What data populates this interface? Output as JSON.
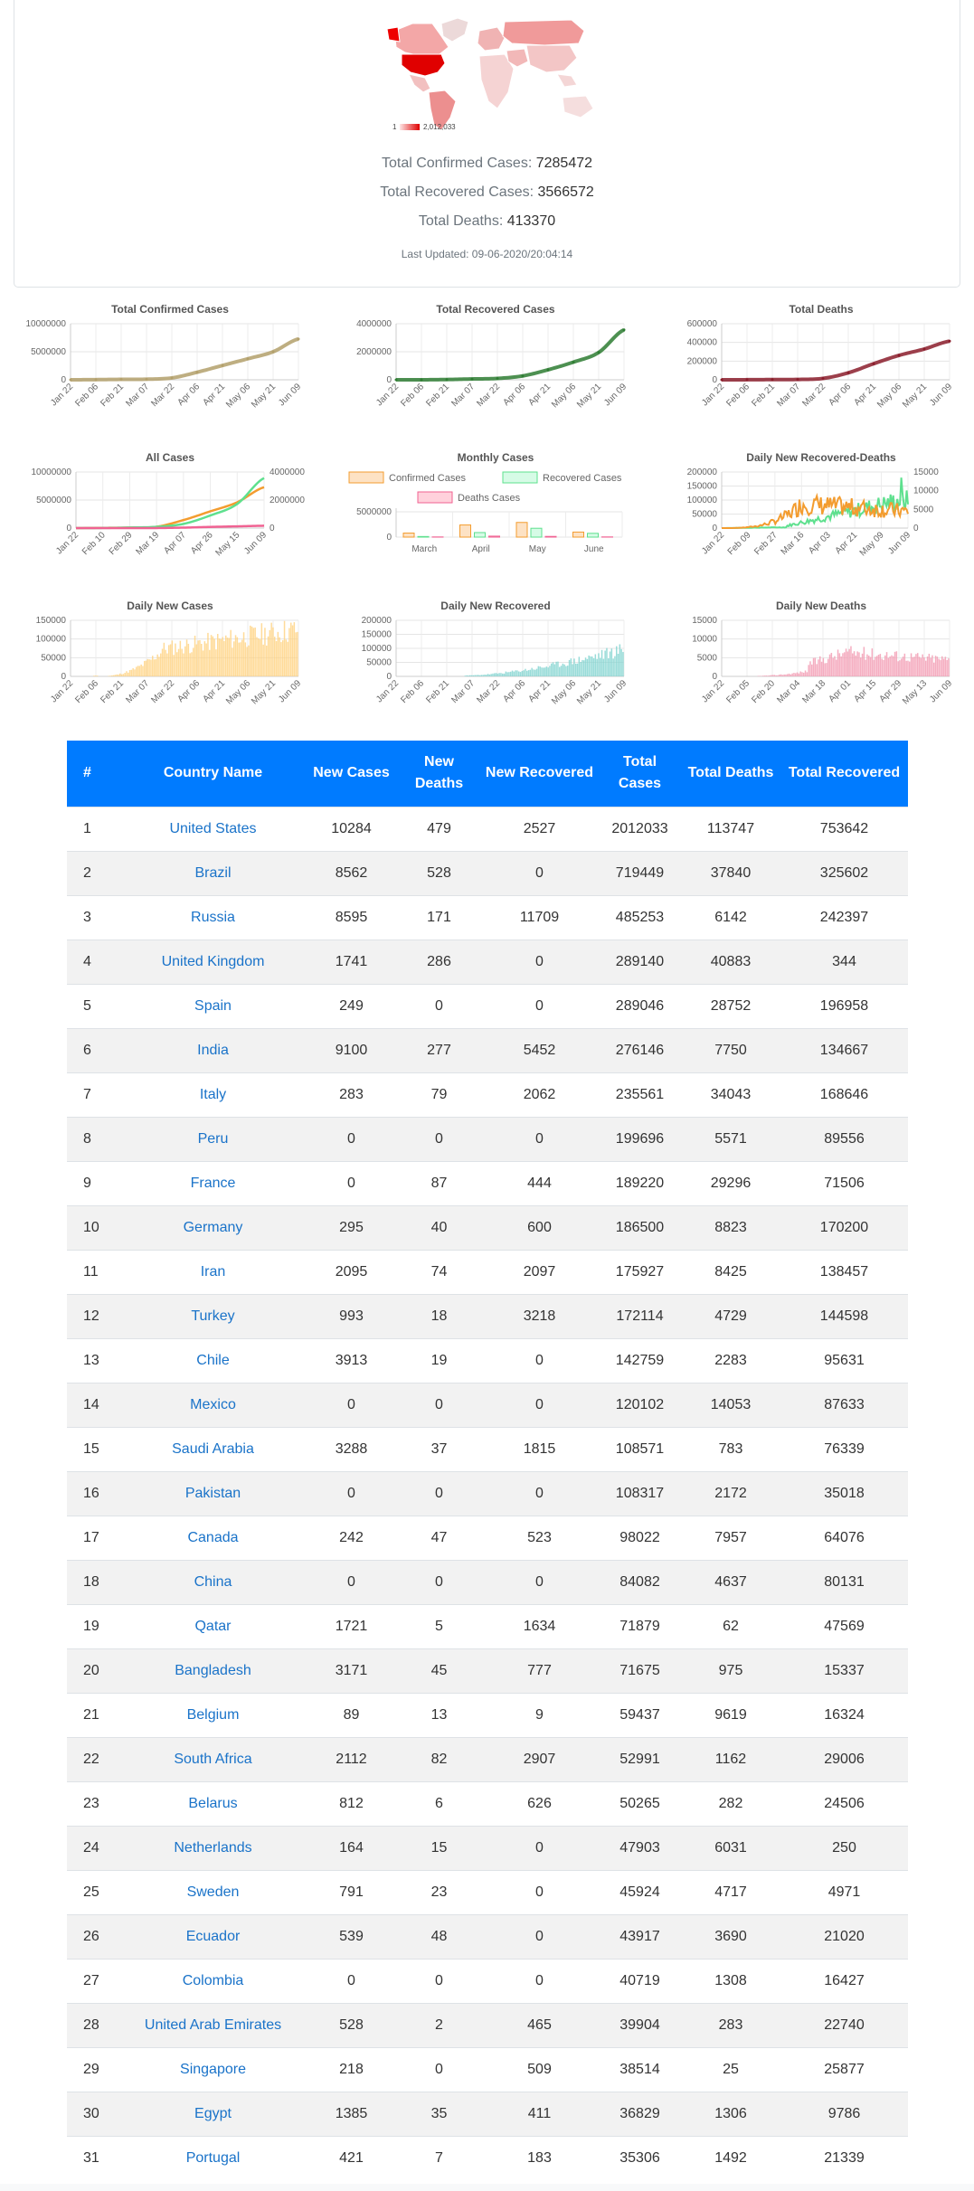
{
  "summary": {
    "map_legend_min": "1",
    "map_legend_max": "2,012,033",
    "confirmed_label": "Total Confirmed Cases:",
    "confirmed_value": "7285472",
    "recovered_label": "Total Recovered Cases:",
    "recovered_value": "3566572",
    "deaths_label": "Total Deaths:",
    "deaths_value": "413370",
    "last_updated": "Last Updated: 09-06-2020/20:04:14"
  },
  "colors": {
    "confirmed": "#b3a06b",
    "recovered": "#2e7d32",
    "deaths": "#8b1d2b",
    "confirmed_fill": "#fde2c4",
    "confirmed_line": "#f39c2f",
    "recovered_fill": "#d6fbe6",
    "recovered_line": "#5ee08e",
    "deaths_fill": "#ffd1dc",
    "deaths_line": "#f06292",
    "daily_cases_bar": "#ffd27f",
    "daily_recovered_bar": "#7fd3d0",
    "daily_deaths_bar": "#f29ab1",
    "table_header_bg": "#007bff",
    "link": "#1a73c9"
  },
  "chart_data": [
    {
      "id": "total_confirmed",
      "type": "line",
      "title": "Total Confirmed Cases",
      "x": [
        "Jan 22",
        "Feb 06",
        "Feb 21",
        "Mar 07",
        "Mar 22",
        "Apr 06",
        "Apr 21",
        "May 06",
        "May 21",
        "Jun 09"
      ],
      "ylim": [
        0,
        10000000
      ],
      "yticks": [
        "10000000",
        "5000000",
        "0"
      ],
      "series": [
        {
          "values": [
            555,
            28000,
            76000,
            106000,
            335000,
            1346000,
            2550000,
            3750000,
            5000000,
            7285472
          ]
        }
      ]
    },
    {
      "id": "total_recovered",
      "type": "line",
      "title": "Total Recovered Cases",
      "x": [
        "Jan 22",
        "Feb 06",
        "Feb 21",
        "Mar 07",
        "Mar 22",
        "Apr 06",
        "Apr 21",
        "May 06",
        "May 21",
        "Jun 09"
      ],
      "ylim": [
        0,
        4000000
      ],
      "yticks": [
        "4000000",
        "2000000",
        "0"
      ],
      "series": [
        {
          "values": [
            28,
            650,
            18900,
            59000,
            97000,
            276000,
            715000,
            1260000,
            1950000,
            3566572
          ]
        }
      ]
    },
    {
      "id": "total_deaths",
      "type": "line",
      "title": "Total Deaths",
      "x": [
        "Jan 22",
        "Feb 06",
        "Feb 21",
        "Mar 07",
        "Mar 22",
        "Apr 06",
        "Apr 21",
        "May 06",
        "May 21",
        "Jun 09"
      ],
      "ylim": [
        0,
        600000
      ],
      "yticks": [
        "600000",
        "400000",
        "200000",
        "0"
      ],
      "series": [
        {
          "values": [
            17,
            636,
            2250,
            3550,
            14800,
            74700,
            172000,
            261000,
            329000,
            413370
          ]
        }
      ]
    },
    {
      "id": "all_cases",
      "type": "line",
      "title": "All Cases",
      "x": [
        "Jan 22",
        "Feb 10",
        "Feb 29",
        "Mar 19",
        "Apr 07",
        "Apr 26",
        "May 15",
        "Jun 09"
      ],
      "ylim": [
        0,
        10000000
      ],
      "yticks": [
        "10000000",
        "5000000",
        "0"
      ],
      "y2ticks": [
        "4000000",
        "2000000",
        "0"
      ],
      "series": [
        {
          "values": [
            555,
            43000,
            86000,
            242000,
            1430000,
            2990000,
            4600000,
            7285472
          ]
        },
        {
          "values": [
            28,
            4700,
            40000,
            88000,
            300000,
            900000,
            1720000,
            3566572
          ]
        },
        {
          "values": [
            17,
            900,
            2900,
            9900,
            82000,
            206000,
            310000,
            413370
          ]
        }
      ]
    },
    {
      "id": "monthly_cases",
      "type": "bar",
      "title": "Monthly Cases",
      "categories": [
        "March",
        "April",
        "May",
        "June"
      ],
      "ylim": [
        0,
        8000000
      ],
      "yticks": [
        "5000000",
        "0"
      ],
      "series": [
        {
          "name": "Confirmed Cases",
          "values": [
            800000,
            2400000,
            2900000,
            1000000
          ]
        },
        {
          "name": "Recovered Cases",
          "values": [
            120000,
            900000,
            1750000,
            750000
          ]
        },
        {
          "name": "Deaths Cases",
          "values": [
            36000,
            195000,
            140000,
            40000
          ]
        }
      ]
    },
    {
      "id": "daily_recovered_deaths",
      "type": "line",
      "title": "Daily New Recovered-Deaths",
      "x": [
        "Jan 22",
        "Feb 09",
        "Feb 27",
        "Mar 16",
        "Apr 03",
        "Apr 21",
        "May 09",
        "Jun 09"
      ],
      "ylim": [
        0,
        200000
      ],
      "yticks": [
        "200000",
        "150000",
        "100000",
        "50000",
        "0"
      ],
      "y2ticks": [
        "15000",
        "10000",
        "5000",
        "0"
      ]
    },
    {
      "id": "daily_new_cases",
      "type": "bar",
      "title": "Daily New Cases",
      "x": [
        "Jan 22",
        "Feb 06",
        "Feb 21",
        "Mar 07",
        "Mar 22",
        "Apr 06",
        "Apr 21",
        "May 06",
        "May 21",
        "Jun 09"
      ],
      "ylim": [
        0,
        150000
      ],
      "yticks": [
        "150000",
        "100000",
        "50000",
        "0"
      ]
    },
    {
      "id": "daily_new_recovered",
      "type": "bar",
      "title": "Daily New Recovered",
      "x": [
        "Jan 22",
        "Feb 06",
        "Feb 21",
        "Mar 07",
        "Mar 22",
        "Apr 06",
        "Apr 21",
        "May 06",
        "May 21",
        "Jun 09"
      ],
      "ylim": [
        0,
        200000
      ],
      "yticks": [
        "200000",
        "150000",
        "100000",
        "50000",
        "0"
      ]
    },
    {
      "id": "daily_new_deaths",
      "type": "bar",
      "title": "Daily New Deaths",
      "x": [
        "Jan 22",
        "Feb 05",
        "Feb 20",
        "Mar 04",
        "Mar 18",
        "Apr 01",
        "Apr 15",
        "Apr 29",
        "May 13",
        "Jun 09"
      ],
      "ylim": [
        0,
        15000
      ],
      "yticks": [
        "15000",
        "10000",
        "5000",
        "0"
      ]
    }
  ],
  "table": {
    "headers": [
      "#",
      "Country Name",
      "New Cases",
      "New Deaths",
      "New Recovered",
      "Total Cases",
      "Total Deaths",
      "Total Recovered"
    ],
    "rows": [
      [
        "1",
        "United States",
        "10284",
        "479",
        "2527",
        "2012033",
        "113747",
        "753642"
      ],
      [
        "2",
        "Brazil",
        "8562",
        "528",
        "0",
        "719449",
        "37840",
        "325602"
      ],
      [
        "3",
        "Russia",
        "8595",
        "171",
        "11709",
        "485253",
        "6142",
        "242397"
      ],
      [
        "4",
        "United Kingdom",
        "1741",
        "286",
        "0",
        "289140",
        "40883",
        "344"
      ],
      [
        "5",
        "Spain",
        "249",
        "0",
        "0",
        "289046",
        "28752",
        "196958"
      ],
      [
        "6",
        "India",
        "9100",
        "277",
        "5452",
        "276146",
        "7750",
        "134667"
      ],
      [
        "7",
        "Italy",
        "283",
        "79",
        "2062",
        "235561",
        "34043",
        "168646"
      ],
      [
        "8",
        "Peru",
        "0",
        "0",
        "0",
        "199696",
        "5571",
        "89556"
      ],
      [
        "9",
        "France",
        "0",
        "87",
        "444",
        "189220",
        "29296",
        "71506"
      ],
      [
        "10",
        "Germany",
        "295",
        "40",
        "600",
        "186500",
        "8823",
        "170200"
      ],
      [
        "11",
        "Iran",
        "2095",
        "74",
        "2097",
        "175927",
        "8425",
        "138457"
      ],
      [
        "12",
        "Turkey",
        "993",
        "18",
        "3218",
        "172114",
        "4729",
        "144598"
      ],
      [
        "13",
        "Chile",
        "3913",
        "19",
        "0",
        "142759",
        "2283",
        "95631"
      ],
      [
        "14",
        "Mexico",
        "0",
        "0",
        "0",
        "120102",
        "14053",
        "87633"
      ],
      [
        "15",
        "Saudi Arabia",
        "3288",
        "37",
        "1815",
        "108571",
        "783",
        "76339"
      ],
      [
        "16",
        "Pakistan",
        "0",
        "0",
        "0",
        "108317",
        "2172",
        "35018"
      ],
      [
        "17",
        "Canada",
        "242",
        "47",
        "523",
        "98022",
        "7957",
        "64076"
      ],
      [
        "18",
        "China",
        "0",
        "0",
        "0",
        "84082",
        "4637",
        "80131"
      ],
      [
        "19",
        "Qatar",
        "1721",
        "5",
        "1634",
        "71879",
        "62",
        "47569"
      ],
      [
        "20",
        "Bangladesh",
        "3171",
        "45",
        "777",
        "71675",
        "975",
        "15337"
      ],
      [
        "21",
        "Belgium",
        "89",
        "13",
        "9",
        "59437",
        "9619",
        "16324"
      ],
      [
        "22",
        "South Africa",
        "2112",
        "82",
        "2907",
        "52991",
        "1162",
        "29006"
      ],
      [
        "23",
        "Belarus",
        "812",
        "6",
        "626",
        "50265",
        "282",
        "24506"
      ],
      [
        "24",
        "Netherlands",
        "164",
        "15",
        "0",
        "47903",
        "6031",
        "250"
      ],
      [
        "25",
        "Sweden",
        "791",
        "23",
        "0",
        "45924",
        "4717",
        "4971"
      ],
      [
        "26",
        "Ecuador",
        "539",
        "48",
        "0",
        "43917",
        "3690",
        "21020"
      ],
      [
        "27",
        "Colombia",
        "0",
        "0",
        "0",
        "40719",
        "1308",
        "16427"
      ],
      [
        "28",
        "United Arab Emirates",
        "528",
        "2",
        "465",
        "39904",
        "283",
        "22740"
      ],
      [
        "29",
        "Singapore",
        "218",
        "0",
        "509",
        "38514",
        "25",
        "25877"
      ],
      [
        "30",
        "Egypt",
        "1385",
        "35",
        "411",
        "36829",
        "1306",
        "9786"
      ],
      [
        "31",
        "Portugal",
        "421",
        "7",
        "183",
        "35306",
        "1492",
        "21339"
      ]
    ]
  }
}
